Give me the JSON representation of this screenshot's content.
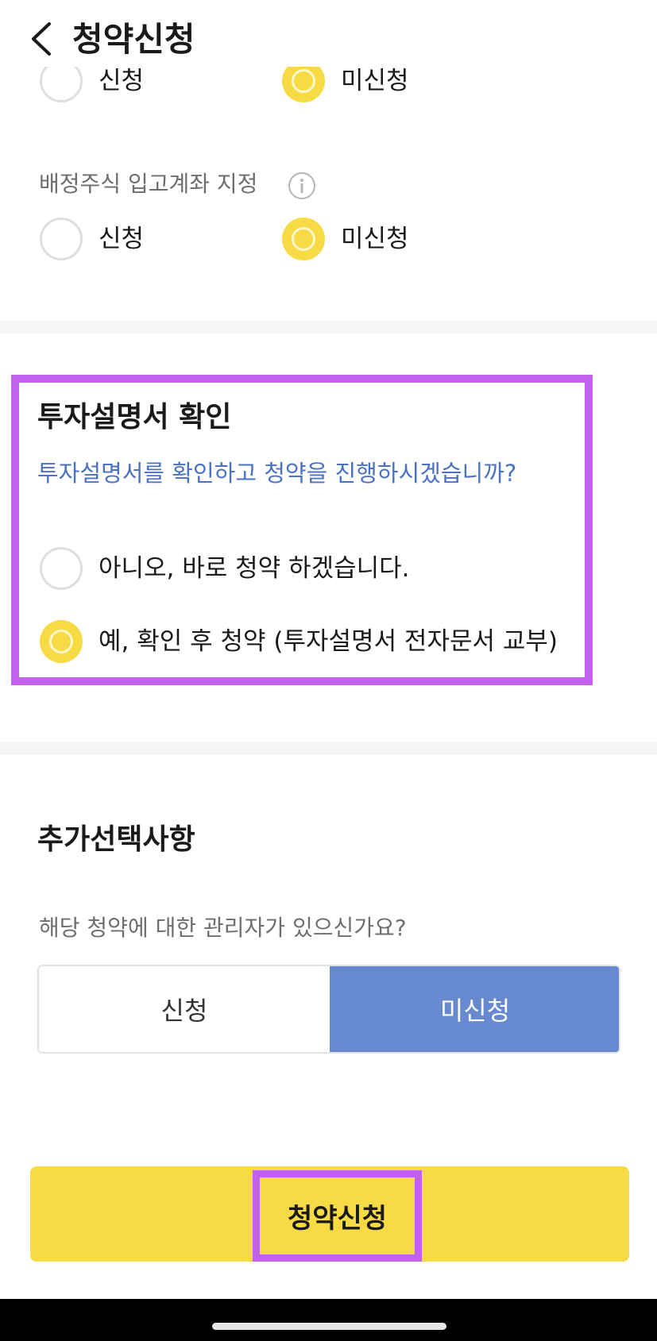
{
  "header": {
    "title": "청약신청",
    "back_icon": "chevron-left-icon"
  },
  "top_partial_options": {
    "option1": "신청",
    "option2": "미신청",
    "selected": "미신청"
  },
  "allocation_account": {
    "label": "배정주식 입고계좌 지정",
    "info_icon": "info-icon",
    "option1": "신청",
    "option2": "미신청",
    "selected": "미신청"
  },
  "prospectus": {
    "title": "투자설명서 확인",
    "question": "투자설명서를 확인하고 청약을 진행하시겠습니까?",
    "option_no": "아니오, 바로 청약 하겠습니다.",
    "option_yes": "예, 확인 후 청약 (투자설명서 전자문서 교부)",
    "selected": "예, 확인 후 청약 (투자설명서 전자문서 교부)"
  },
  "additional": {
    "title": "추가선택사항",
    "question": "해당 청약에 대한 관리자가 있으신가요?",
    "option1": "신청",
    "option2": "미신청",
    "selected": "미신청"
  },
  "submit": {
    "label": "청약신청"
  },
  "colors": {
    "accent_yellow": "#f8da45",
    "selected_blue": "#6689d0",
    "highlight_purple": "#c460ee",
    "question_blue": "#4a72c4"
  }
}
